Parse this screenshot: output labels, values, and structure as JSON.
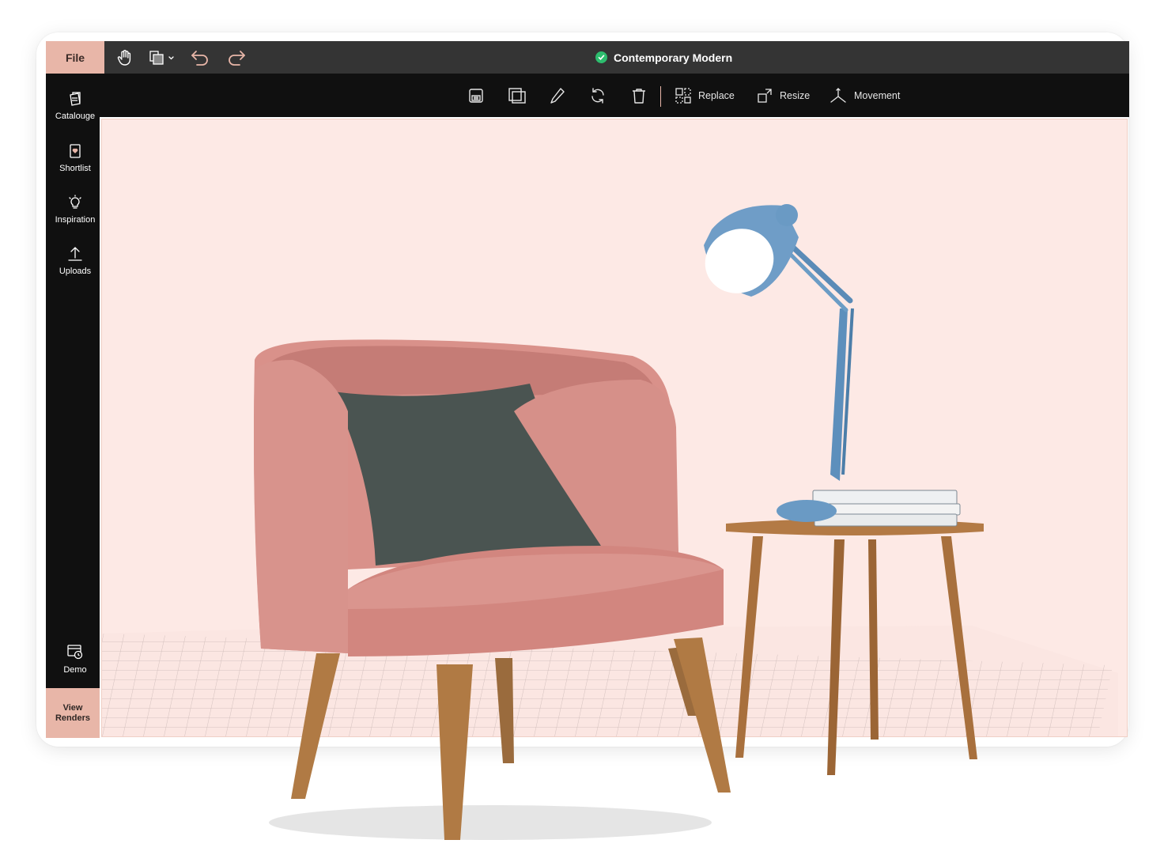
{
  "app": {
    "file_label": "File",
    "title": "Contemporary Modern",
    "title_status_icon": "check-circle-icon",
    "accent_color": "#e8b6a8",
    "status_color": "#2dbd6e"
  },
  "titlebar": {
    "icons": [
      "hand-icon",
      "layers-icon",
      "undo-icon",
      "redo-icon"
    ]
  },
  "toolbar": {
    "icons": [
      "save-icon",
      "duplicate-icon",
      "edit-icon",
      "rotate-icon",
      "delete-icon"
    ],
    "replace_label": "Replace",
    "resize_label": "Resize",
    "movement_label": "Movement"
  },
  "sidebar": {
    "items": [
      {
        "label": "Catalouge",
        "icon": "catalogue-icon"
      },
      {
        "label": "Shortlist",
        "icon": "shortlist-icon"
      },
      {
        "label": "Inspiration",
        "icon": "bulb-icon"
      },
      {
        "label": "Uploads",
        "icon": "upload-icon"
      }
    ],
    "demo_label": "Demo",
    "view_renders_line1": "View",
    "view_renders_line2": "Renders"
  },
  "canvas": {
    "background_color": "#fde9e5",
    "objects": [
      "armchair",
      "cushion",
      "side-table",
      "desk-lamp",
      "books"
    ]
  }
}
